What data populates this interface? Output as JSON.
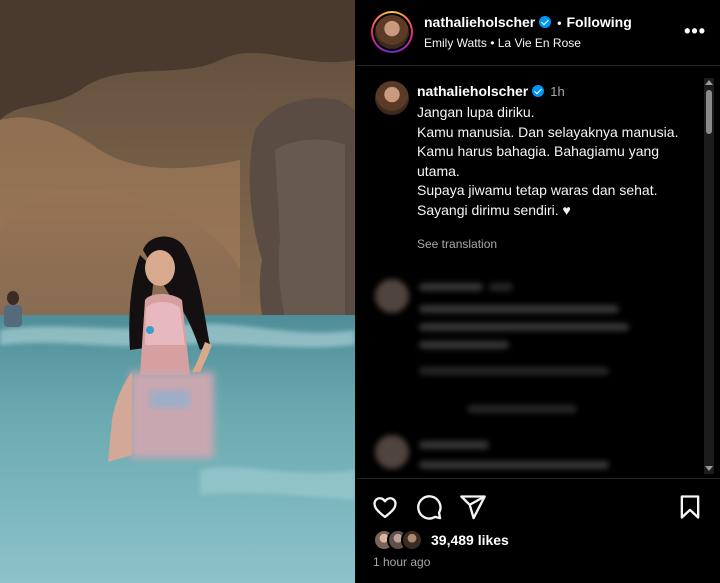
{
  "header": {
    "username": "nathalieholscher",
    "follow_label": "Following",
    "music": "Emily Watts • La Vie En Rose",
    "more_icon": "more-horizontal-icon"
  },
  "caption": {
    "username": "nathalieholscher",
    "time": "1h",
    "lines": [
      "Jangan lupa diriku.",
      "Kamu manusia. Dan selayaknya manusia.",
      "Kamu harus bahagia. Bahagiamu yang utama.",
      "Supaya jiwamu tetap waras dan sehat.",
      "Sayangi dirimu sendiri. ♥"
    ],
    "see_translation": "See translation"
  },
  "actions": {
    "icons": [
      "heart-icon",
      "comment-icon",
      "share-icon",
      "bookmark-icon"
    ],
    "likes": "39,489 likes",
    "post_time": "1 hour ago"
  },
  "colors": {
    "verified": "#0095f6",
    "background": "#000000",
    "muted_text": "#a8a8a8"
  }
}
